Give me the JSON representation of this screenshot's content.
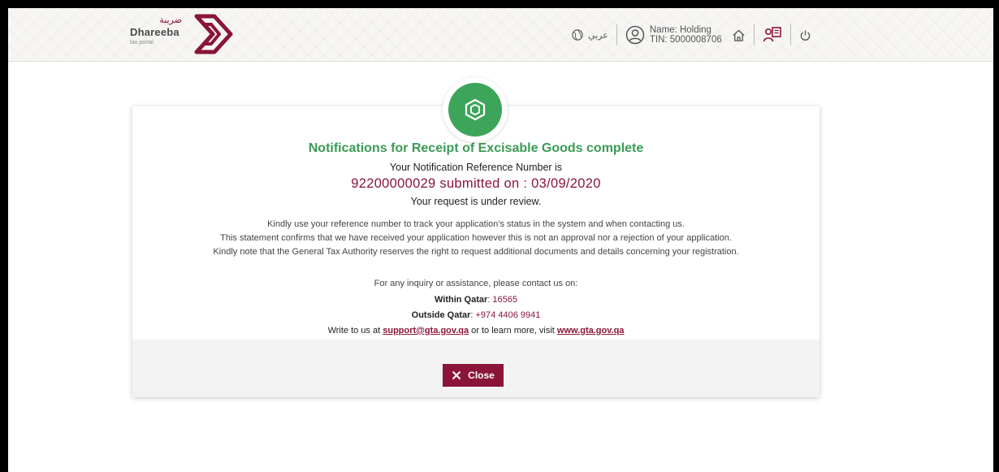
{
  "header": {
    "logo": {
      "arabic": "ضريبة",
      "name": "Dhareeba",
      "sub": "tax portal"
    },
    "language_label": "عربي",
    "user": {
      "name": "Name: Holding",
      "tin": "TIN: 5000008706"
    }
  },
  "card": {
    "title": "Notifications for Receipt of Excisable Goods complete",
    "ref_label": "Your Notification Reference Number is",
    "ref_text": "92200000029 submitted on : 03/09/2020",
    "review_text": "Your request is under review.",
    "paragraphs": [
      "Kindly use your reference number to track your application's status in the system and when contacting us.",
      "This statement confirms that we have received your application however this is not an approval nor a rejection of your application.",
      "Kindly note that the General Tax Authority reserves the right to request additional documents and details concerning your registration."
    ],
    "inquiry": "For any inquiry or assistance, please contact us on:",
    "within_label": "Within Qatar",
    "within_value": ": 16565",
    "outside_label": "Outside Qatar",
    "outside_value": ": +974 4406 9941",
    "write_prefix": "Write to us at",
    "email": "support@gta.gov.qa",
    "write_middle": "or to learn more, visit",
    "website": "www.gta.gov.qa"
  },
  "footer": {
    "close_label": "Close"
  },
  "colors": {
    "brand": "#8a1538",
    "success": "#3da55a",
    "title": "#3a9b55"
  }
}
